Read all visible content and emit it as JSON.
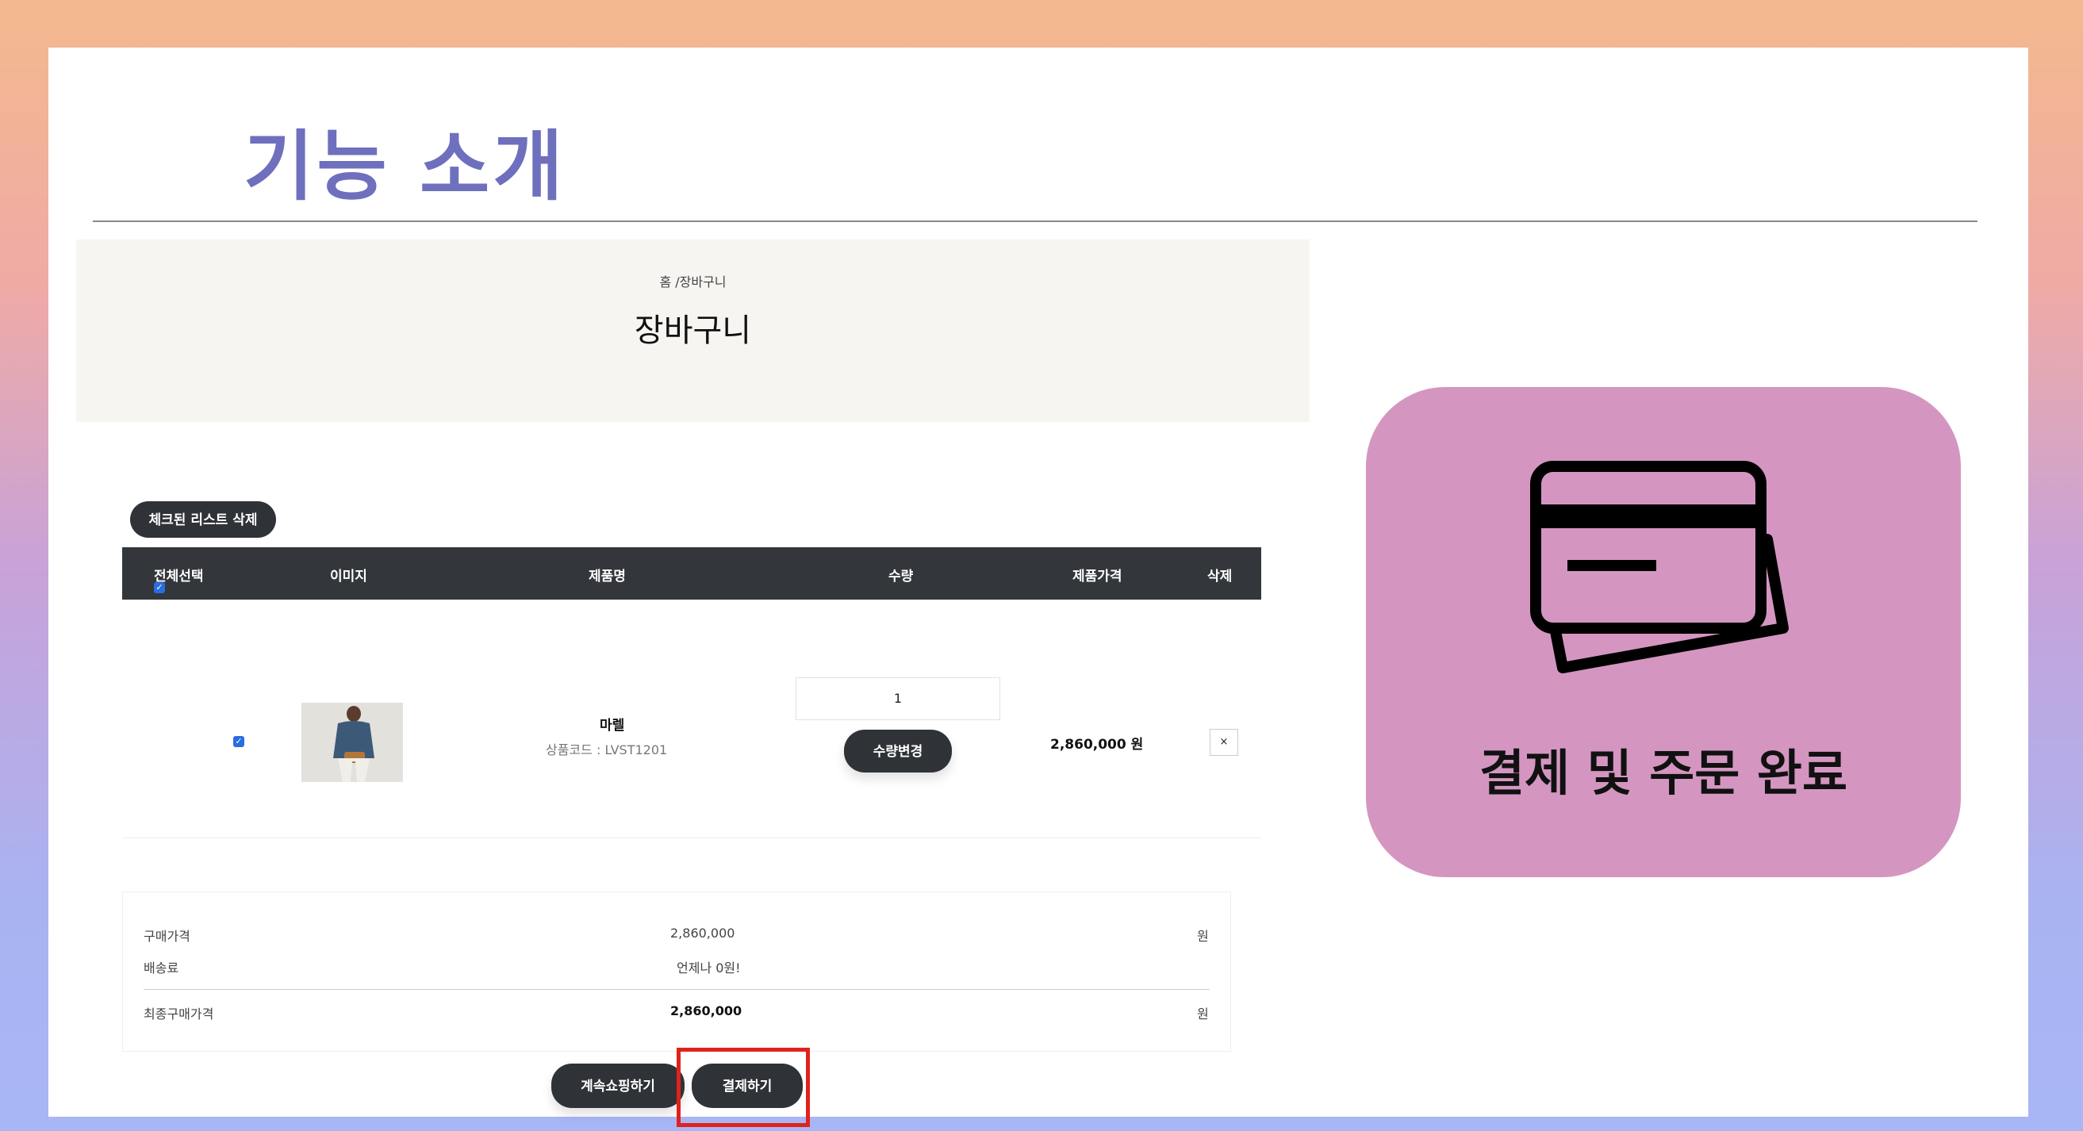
{
  "slide": {
    "title": "기능 소개"
  },
  "cart_page": {
    "breadcrumb": "홈 /장바구니",
    "heading": "장바구니",
    "delete_checked_label": "체크된 리스트 삭제",
    "table_headers": {
      "select_all": "전체선택",
      "image": "이미지",
      "product_name": "제품명",
      "quantity": "수량",
      "price": "제품가격",
      "delete": "삭제"
    },
    "item": {
      "checked": true,
      "name": "마렐",
      "code": "상품코드 : LVST1201",
      "quantity": "1",
      "quantity_change_label": "수량변경",
      "price": "2,860,000 원",
      "remove_label": "×"
    },
    "summary": {
      "purchase_label": "구매가격",
      "purchase_value": "2,860,000",
      "purchase_unit": "원",
      "shipping_label": "배송료",
      "shipping_value": "언제나 0원!",
      "final_label": "최종구매가격",
      "final_value": "2,860,000",
      "final_unit": "원"
    },
    "continue_label": "계속쇼핑하기",
    "checkout_label": "결제하기"
  },
  "feature_card": {
    "icon": "credit-card-icon",
    "label": "결제 및 주문 완료",
    "color": "#d496c1"
  },
  "colors": {
    "accent_title": "#6e6fbd",
    "highlight": "#e0221c",
    "button_dark": "#2f3237"
  }
}
